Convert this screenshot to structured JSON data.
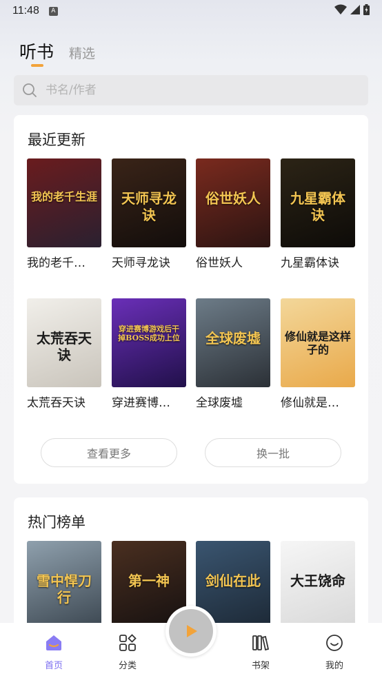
{
  "status_bar": {
    "time": "11:48",
    "notif_glyph": "A"
  },
  "tabs": {
    "active": "听书",
    "other": "精选"
  },
  "search": {
    "placeholder": "书名/作者"
  },
  "recent": {
    "title": "最近更新",
    "books": [
      {
        "title": "我的老千…",
        "cover_text": "我的老千生涯",
        "cover_colors": [
          "#6a1c1e",
          "#2a2030"
        ]
      },
      {
        "title": "天师寻龙诀",
        "cover_text": "天师寻龙诀",
        "cover_colors": [
          "#3a2418",
          "#120d0b"
        ]
      },
      {
        "title": "俗世妖人",
        "cover_text": "俗世妖人",
        "cover_colors": [
          "#7a2a1e",
          "#2b1412"
        ]
      },
      {
        "title": "九星霸体诀",
        "cover_text": "九星霸体诀",
        "cover_colors": [
          "#2c2416",
          "#0d0b08"
        ]
      },
      {
        "title": "太荒吞天诀",
        "cover_text": "太荒吞天诀",
        "cover_colors": [
          "#f1efea",
          "#c9c4bb"
        ]
      },
      {
        "title": "穿进赛博…",
        "cover_text": "穿进赛博游戏后干掉BOSS成功上位",
        "cover_colors": [
          "#6a2fb8",
          "#21104a"
        ]
      },
      {
        "title": "全球废墟",
        "cover_text": "全球废墟",
        "cover_colors": [
          "#6d7c88",
          "#2b3036"
        ]
      },
      {
        "title": "修仙就是…",
        "cover_text": "修仙就是这样子的",
        "cover_colors": [
          "#f3d79a",
          "#e9a94a"
        ]
      }
    ],
    "more_label": "查看更多",
    "refresh_label": "换一批"
  },
  "hot": {
    "title": "热门榜单",
    "books": [
      {
        "cover_text": "雪中悍刀行",
        "cover_colors": [
          "#8fa0ad",
          "#3b4650"
        ]
      },
      {
        "cover_text": "第一神",
        "cover_colors": [
          "#4a2f20",
          "#151010"
        ]
      },
      {
        "cover_text": "剑仙在此",
        "cover_colors": [
          "#3a5570",
          "#1c2835"
        ]
      },
      {
        "cover_text": "大王饶命",
        "cover_colors": [
          "#f6f6f6",
          "#d8d8d8"
        ]
      }
    ]
  },
  "nav": {
    "home": "首页",
    "category": "分类",
    "shelf": "书架",
    "mine": "我的"
  },
  "colors": {
    "accent": "#7a6cf0",
    "tab_underline": "#f2a33a"
  }
}
